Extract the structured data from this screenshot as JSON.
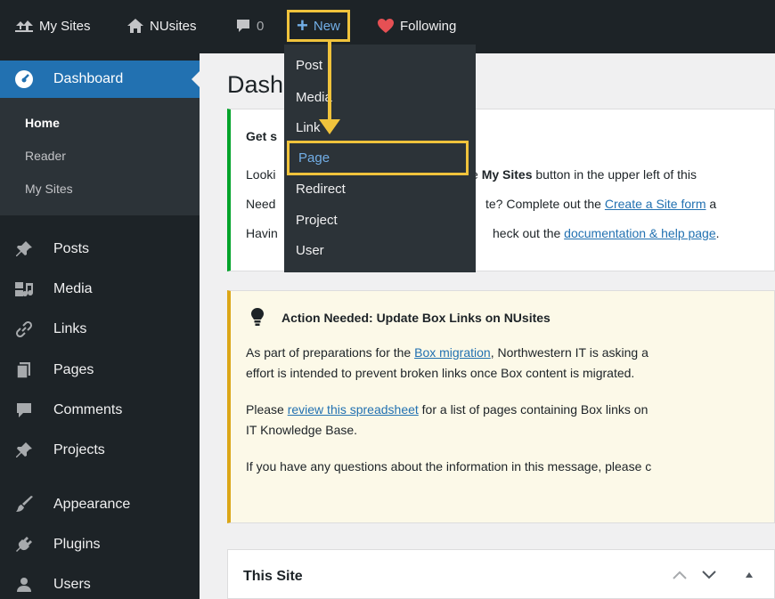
{
  "admin_bar": {
    "my_sites": "My Sites",
    "site_name": "NUsites",
    "comments_count": "0",
    "new_label": "New",
    "following_label": "Following"
  },
  "new_menu": {
    "items": [
      "Post",
      "Media",
      "Link",
      "Page",
      "Redirect",
      "Project",
      "User"
    ],
    "highlighted": "Page"
  },
  "sidebar": {
    "dashboard_label": "Dashboard",
    "submenu": [
      "Home",
      "Reader",
      "My Sites"
    ],
    "items": [
      {
        "label": "Posts",
        "icon": "pin-icon"
      },
      {
        "label": "Media",
        "icon": "media-icon"
      },
      {
        "label": "Links",
        "icon": "link-icon"
      },
      {
        "label": "Pages",
        "icon": "pages-icon"
      },
      {
        "label": "Comments",
        "icon": "comment-icon"
      },
      {
        "label": "Projects",
        "icon": "pin-icon"
      },
      {
        "label": "Appearance",
        "icon": "brush-icon"
      },
      {
        "label": "Plugins",
        "icon": "plugin-icon"
      },
      {
        "label": "Users",
        "icon": "user-icon"
      }
    ]
  },
  "main": {
    "title": "Dash",
    "welcome": {
      "heading": "Get s",
      "line1_start": "Looki",
      "line1_mid": "e ",
      "line1_bold": "My Sites",
      "line1_end": " button in the upper left of this",
      "line2_start": "Need",
      "line2_mid": "te? Complete out the ",
      "line2_link": "Create a Site form",
      "line2_end": " a",
      "line3_start": "Havin",
      "line3_mid": "heck out the ",
      "line3_link": "documentation & help page",
      "line3_end": "."
    },
    "notice": {
      "title": "Action Needed: Update Box Links on NUsites",
      "p1_start": "As part of preparations for the ",
      "p1_link": "Box migration",
      "p1_end": ", Northwestern IT is asking a",
      "p1_line2": "effort is intended to prevent broken links once Box content is migrated.",
      "p2_start": "Please ",
      "p2_link": "review this spreadsheet",
      "p2_end": " for a list of pages containing Box links on",
      "p2_line2": "IT Knowledge Base.",
      "p3": "If you have any questions about the information in this message, please c"
    },
    "this_site": {
      "title": "This Site"
    }
  },
  "colors": {
    "admin_bar": "#1d2327",
    "accent": "#2271b1",
    "highlight": "#f0c33c",
    "success_border": "#00a32a",
    "warning_border": "#dba617"
  }
}
